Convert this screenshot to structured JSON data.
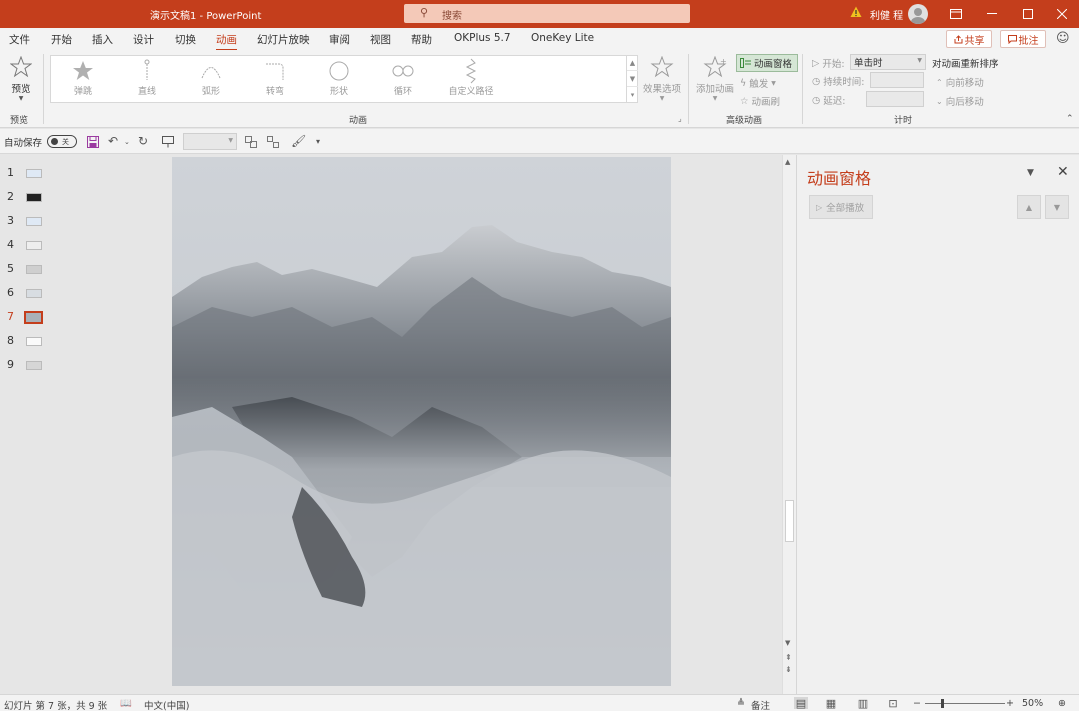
{
  "titlebar": {
    "title": "演示文稿1  -  PowerPoint",
    "search_placeholder": "搜索",
    "user_name": "利健 程",
    "accent": "#c43e1c"
  },
  "tabs": [
    {
      "label": "文件"
    },
    {
      "label": "开始"
    },
    {
      "label": "插入"
    },
    {
      "label": "设计"
    },
    {
      "label": "切换"
    },
    {
      "label": "动画",
      "active": true
    },
    {
      "label": "幻灯片放映"
    },
    {
      "label": "审阅"
    },
    {
      "label": "视图"
    },
    {
      "label": "帮助"
    },
    {
      "label": "OKPlus 5.7"
    },
    {
      "label": "OneKey Lite"
    }
  ],
  "actions": {
    "share": "共享",
    "comment": "批注"
  },
  "ribbon": {
    "preview": {
      "label": "预览",
      "group": "预览"
    },
    "animations": {
      "items": [
        "弹跳",
        "直线",
        "弧形",
        "转弯",
        "形状",
        "循环",
        "自定义路径"
      ],
      "group": "动画",
      "effect_options": "效果选项"
    },
    "advanced": {
      "add_animation": "添加动画",
      "animation_pane": "动画窗格",
      "trigger": "触发",
      "painter": "动画刷",
      "group": "高级动画"
    },
    "timing": {
      "start_label": "开始:",
      "start_value": "单击时",
      "duration_label": "持续时间:",
      "delay_label": "延迟:",
      "reorder": "对动画重新排序",
      "move_earlier": "向前移动",
      "move_later": "向后移动",
      "group": "计时"
    }
  },
  "qat": {
    "autosave": "自动保存",
    "toggle": "关"
  },
  "slides": [
    {
      "num": "1"
    },
    {
      "num": "2"
    },
    {
      "num": "3"
    },
    {
      "num": "4"
    },
    {
      "num": "5"
    },
    {
      "num": "6"
    },
    {
      "num": "7",
      "active": true
    },
    {
      "num": "8"
    },
    {
      "num": "9"
    }
  ],
  "pane": {
    "title": "动画窗格",
    "play_all": "全部播放"
  },
  "statusbar": {
    "slide_info": "幻灯片 第 7 张，共 9 张",
    "language": "中文(中国)",
    "notes": "备注",
    "zoom": "50%"
  }
}
